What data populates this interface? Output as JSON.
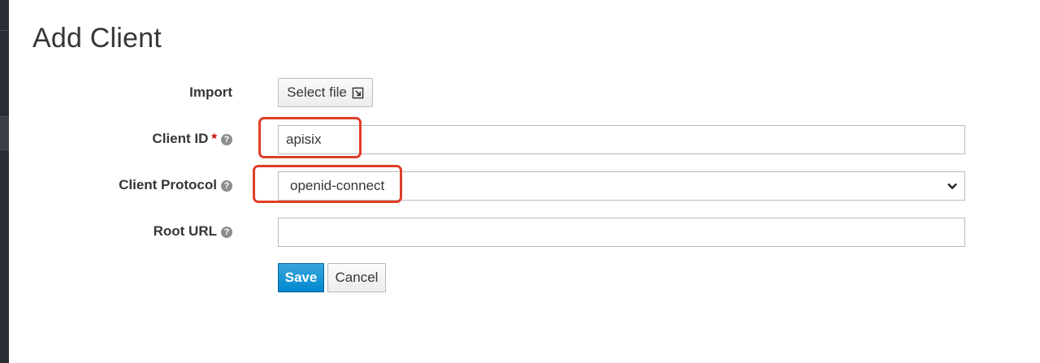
{
  "page": {
    "title": "Add Client"
  },
  "form": {
    "import": {
      "label": "Import",
      "button_label": "Select file"
    },
    "client_id": {
      "label": "Client ID",
      "required_mark": "*",
      "value": "apisix"
    },
    "client_protocol": {
      "label": "Client Protocol",
      "value": "openid-connect"
    },
    "root_url": {
      "label": "Root URL",
      "value": ""
    },
    "help_glyph": "?"
  },
  "actions": {
    "save_label": "Save",
    "cancel_label": "Cancel"
  },
  "colors": {
    "primary": "#0088ce",
    "highlight": "#e03d2a",
    "rail": "#292e34"
  }
}
